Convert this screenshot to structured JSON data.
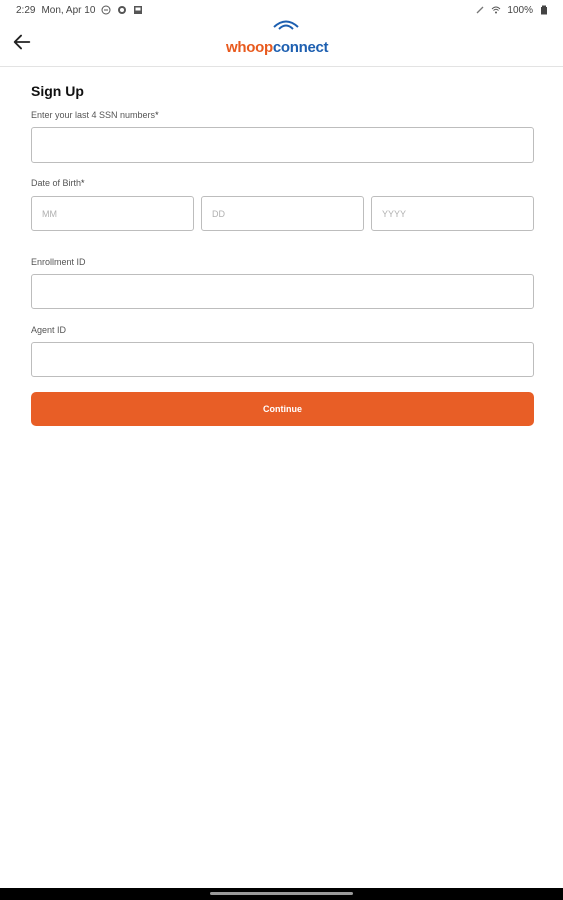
{
  "status_bar": {
    "time": "2:29",
    "date": "Mon, Apr 10",
    "battery": "100%"
  },
  "app_bar": {
    "logo_part1": "whoop",
    "logo_part2": "connect"
  },
  "form": {
    "title": "Sign Up",
    "ssn_label": "Enter your last 4 SSN numbers",
    "ssn_required": "*",
    "dob_label": "Date of Birth",
    "dob_required": "*",
    "dob_month_placeholder": "MM",
    "dob_day_placeholder": "DD",
    "dob_year_placeholder": "YYYY",
    "enrollment_label": "Enrollment ID",
    "agent_label": "Agent ID",
    "continue_label": "Continue"
  },
  "colors": {
    "brand_orange": "#e85e26",
    "brand_blue": "#1d5fb0"
  }
}
